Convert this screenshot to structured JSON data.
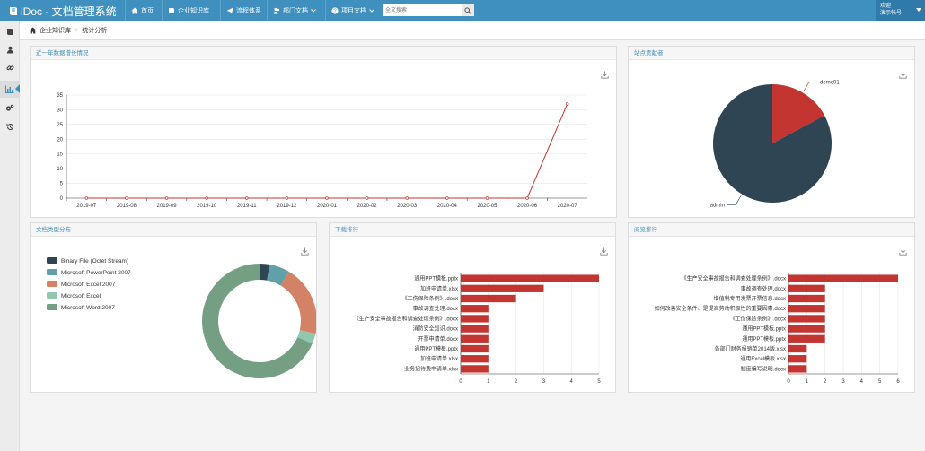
{
  "brand": {
    "title": "iDoc - 文档管理系统"
  },
  "nav": [
    {
      "label": "首页",
      "icon": "home-icon",
      "dropdown": false
    },
    {
      "label": "企业知识库",
      "icon": "book-icon",
      "dropdown": false
    },
    {
      "label": "流程体系",
      "icon": "send-icon",
      "dropdown": false
    },
    {
      "label": "部门文档",
      "icon": "users-icon",
      "dropdown": true
    },
    {
      "label": "项目文档",
      "icon": "question-circle-icon",
      "dropdown": true
    }
  ],
  "search": {
    "placeholder": "全文搜索"
  },
  "user": {
    "greeting": "欢迎",
    "name": "演示帐号"
  },
  "sidebar": [
    "book-icon",
    "user-icon",
    "link-icon",
    "bar-chart-icon",
    "gears-icon",
    "history-icon"
  ],
  "breadcrumb": {
    "home": "企业知识库",
    "current": "统计分析"
  },
  "panels": {
    "growth": "近一年数据增长情况",
    "sites": "站点贡献者",
    "types": "文档类型分布",
    "downloads": "下载排行",
    "views": "阅览排行"
  },
  "chart_data": [
    {
      "type": "line",
      "title": "近一年数据增长情况",
      "categories": [
        "2019-07",
        "2019-08",
        "2019-09",
        "2019-10",
        "2019-11",
        "2019-12",
        "2020-01",
        "2020-02",
        "2020-03",
        "2020-04",
        "2020-05",
        "2020-06",
        "2020-07"
      ],
      "values": [
        0,
        0,
        0,
        0,
        0,
        0,
        0,
        0,
        0,
        0,
        0,
        0,
        32
      ],
      "ylim": [
        0,
        35
      ],
      "yticks": [
        0,
        5,
        10,
        15,
        20,
        25,
        30,
        35
      ],
      "color": "#c23531"
    },
    {
      "type": "pie",
      "title": "站点贡献者",
      "labels": [
        "demo01",
        "admin"
      ],
      "values": [
        6,
        29
      ],
      "colors": [
        "#c23531",
        "#2f4554"
      ]
    },
    {
      "type": "pie",
      "title": "文档类型分布",
      "labels": [
        "Binary File (Octet Stream)",
        "Microsoft PowerPoint 2007",
        "Microsoft Excel 2007",
        "Microsoft Excel",
        "Microsoft Word 2007"
      ],
      "values": [
        1,
        2,
        7,
        1,
        24
      ],
      "colors": [
        "#2f4554",
        "#61a0a8",
        "#d48265",
        "#91c7ae",
        "#749f83"
      ]
    },
    {
      "type": "bar",
      "title": "下载排行",
      "categories": [
        "通用PPT模板.pptx",
        "加班申请单.xlsx",
        "《工伤保险条例》.docx",
        "事故调查处理.docx",
        "《生产安全事故报告和调查处理条例》.docx",
        "消防安全知识.docx",
        "开票申请单.docx",
        "通用PPT模板.pptx",
        "加班申请单.xlsx",
        "业务招待费申请单.xlsx"
      ],
      "values": [
        5,
        3,
        2,
        1,
        1,
        1,
        1,
        1,
        1,
        1
      ],
      "xticks": [
        0,
        1,
        2,
        3,
        4,
        5
      ],
      "xlim": [
        0,
        5
      ],
      "color": "#c23531"
    },
    {
      "type": "bar",
      "title": "阅览排行",
      "categories": [
        "《生产安全事故报告和调查处理条例》.docx",
        "事故调查处理.docx",
        "增值税专用发票开票信息.docx",
        "如何改善安全条件、是提高劳动积极性的重要因素.docx",
        "《工伤保险条例》.docx",
        "通用PPT模板.pptx",
        "通用PPT模板.pptx",
        "各部门财务报销单2014版.xlsx",
        "通用Excel模板.xlsx",
        "制度编写说明.docx"
      ],
      "values": [
        6,
        2,
        2,
        2,
        2,
        2,
        2,
        1,
        1,
        1
      ],
      "xticks": [
        0,
        1,
        2,
        3,
        4,
        5,
        6
      ],
      "xlim": [
        0,
        6
      ],
      "color": "#c23531"
    }
  ]
}
